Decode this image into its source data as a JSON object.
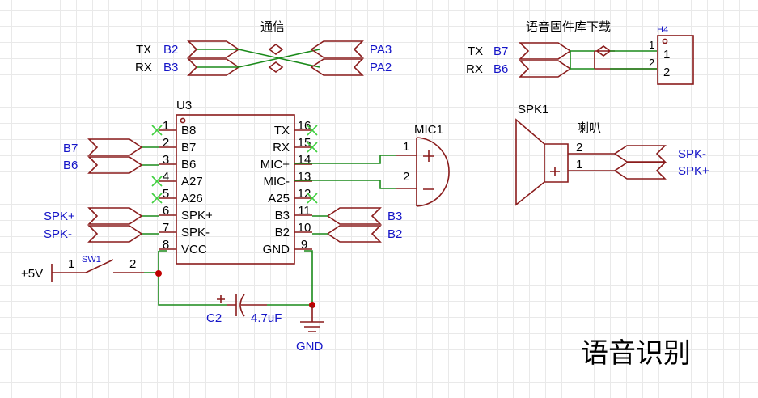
{
  "title": "语音识别",
  "sections": {
    "comm": "通信",
    "firmware": "语音固件库下载"
  },
  "u3": {
    "ref": "U3",
    "left_pins": [
      {
        "num": "1",
        "name": "B8",
        "nc": true
      },
      {
        "num": "2",
        "name": "B7",
        "nc": false
      },
      {
        "num": "3",
        "name": "B6",
        "nc": false
      },
      {
        "num": "4",
        "name": "A27",
        "nc": true
      },
      {
        "num": "5",
        "name": "A26",
        "nc": true
      },
      {
        "num": "6",
        "name": "SPK+",
        "nc": false
      },
      {
        "num": "7",
        "name": "SPK-",
        "nc": false
      },
      {
        "num": "8",
        "name": "VCC",
        "nc": false
      }
    ],
    "right_pins": [
      {
        "num": "16",
        "name": "TX",
        "nc": true
      },
      {
        "num": "15",
        "name": "RX",
        "nc": true
      },
      {
        "num": "14",
        "name": "MIC+",
        "nc": false
      },
      {
        "num": "13",
        "name": "MIC-",
        "nc": false
      },
      {
        "num": "12",
        "name": "A25",
        "nc": true
      },
      {
        "num": "11",
        "name": "B3",
        "nc": false
      },
      {
        "num": "10",
        "name": "B2",
        "nc": false
      },
      {
        "num": "9",
        "name": "GND",
        "nc": false
      }
    ]
  },
  "comm_ports": {
    "left": [
      {
        "tag": "TX",
        "net": "B2"
      },
      {
        "tag": "RX",
        "net": "B3"
      }
    ],
    "right": [
      {
        "net": "PA3"
      },
      {
        "net": "PA2"
      }
    ]
  },
  "firmware_ports": [
    {
      "tag": "TX",
      "net": "B7"
    },
    {
      "tag": "RX",
      "net": "B6"
    }
  ],
  "h4": {
    "ref": "H4",
    "pins": [
      "1",
      "2"
    ],
    "pin_labels": [
      "1",
      "2"
    ]
  },
  "left_ports": {
    "top": [
      "B7",
      "B6"
    ],
    "bottom": [
      "SPK+",
      "SPK-"
    ]
  },
  "right_ports": [
    "B3",
    "B2"
  ],
  "mic": {
    "ref": "MIC1",
    "pins": [
      "1",
      "2"
    ],
    "plus": "+",
    "minus": "−"
  },
  "speaker": {
    "ref": "SPK1",
    "label": "喇叭",
    "pins": [
      "2",
      "1"
    ],
    "plus": "+",
    "ports": [
      "SPK-",
      "SPK+"
    ]
  },
  "switch": {
    "ref": "SW1",
    "pins": [
      "1",
      "2"
    ],
    "supply": "+5V"
  },
  "cap": {
    "ref": "C2",
    "value": "4.7uF",
    "plus": "+"
  },
  "ground": {
    "label": "GND"
  },
  "colors": {
    "symbol": "#8a1c1c",
    "wire": "#1a8a1a",
    "net_label": "#1515c8",
    "noconnect": "#3fcf3f"
  }
}
